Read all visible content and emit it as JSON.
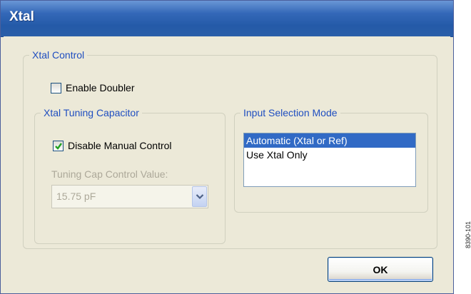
{
  "window": {
    "title": "Xtal"
  },
  "xtal_control": {
    "legend": "Xtal Control",
    "enable_doubler": {
      "label": "Enable Doubler",
      "checked": false
    }
  },
  "tuning_cap": {
    "legend": "Xtal Tuning Capacitor",
    "disable_manual": {
      "label": "Disable Manual Control",
      "checked": true
    },
    "control_label": "Tuning Cap Control Value:",
    "combo_value": "15.75 pF"
  },
  "input_mode": {
    "legend": "Input Selection Mode",
    "options": [
      {
        "label": "Automatic (Xtal or Ref)",
        "selected": true
      },
      {
        "label": "Use Xtal Only",
        "selected": false
      }
    ]
  },
  "ok_button": {
    "label": "OK"
  },
  "figure_code": "8390-101",
  "colors": {
    "title_bar": "#245aa8",
    "legend_text": "#1f4ec0",
    "selection": "#316ac5",
    "check": "#21a121",
    "disabled_text": "#aca899"
  }
}
